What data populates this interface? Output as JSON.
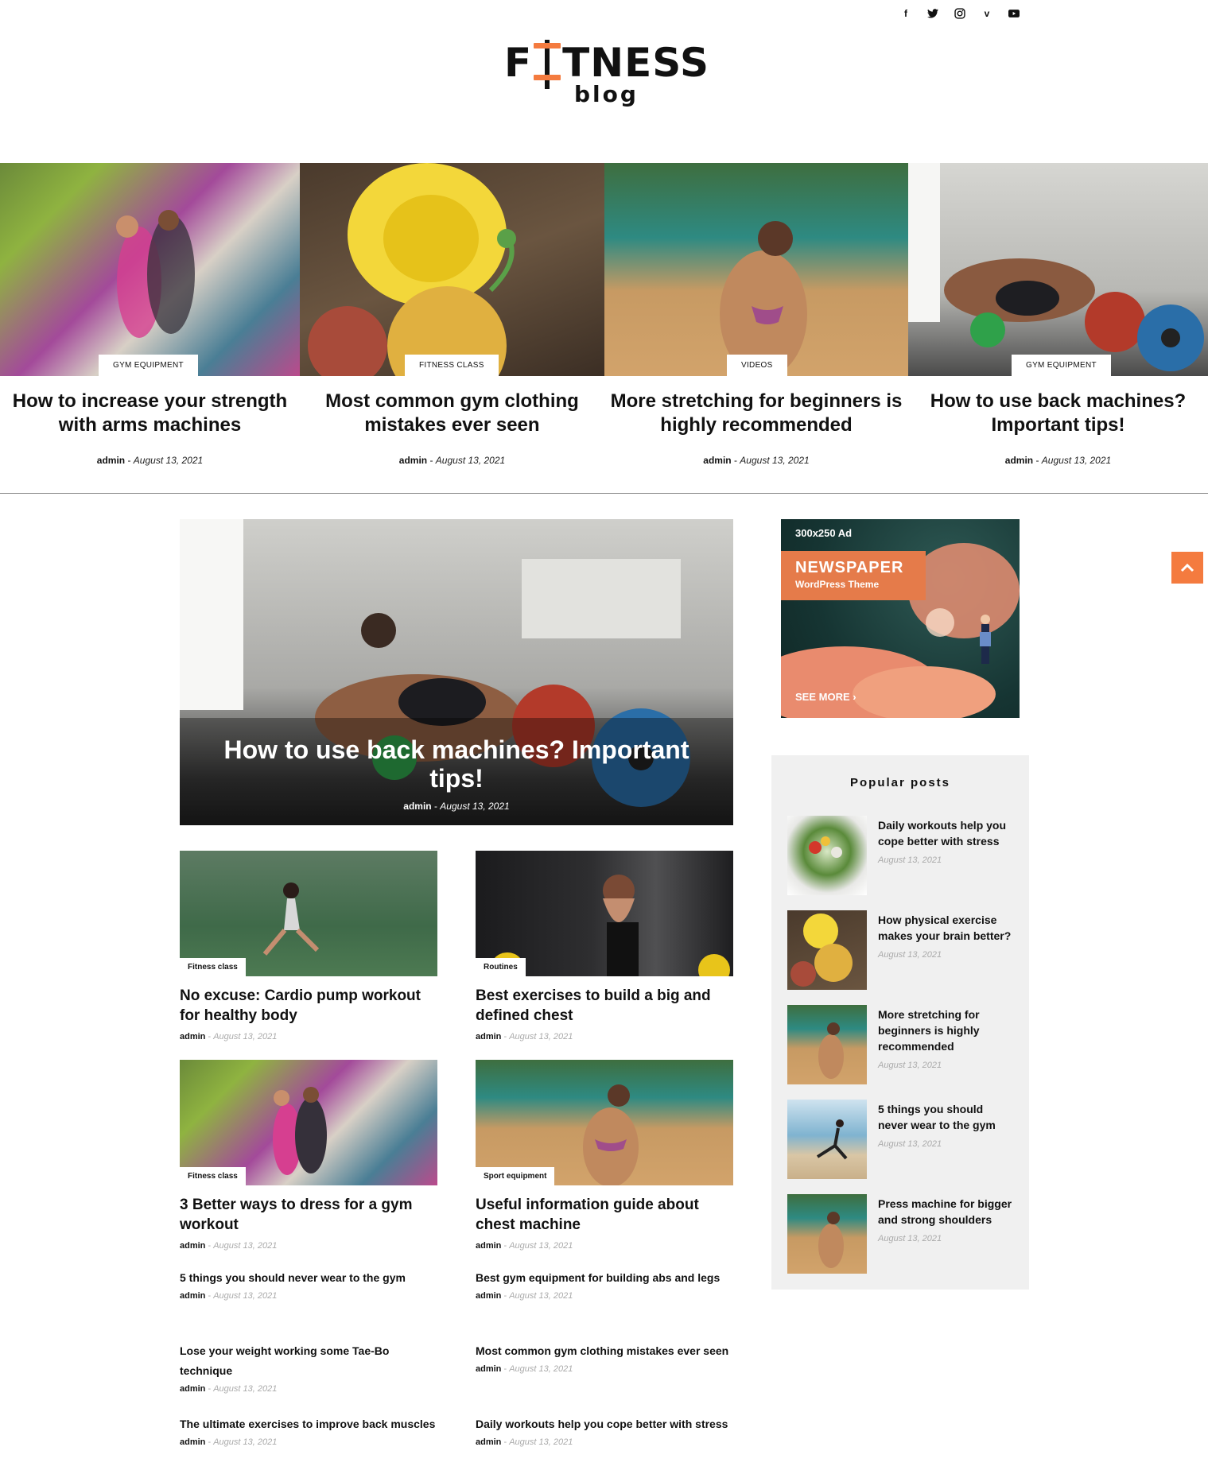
{
  "social": [
    {
      "icon": "facebook-icon",
      "glyph": "f"
    },
    {
      "icon": "twitter-icon",
      "glyph": "t"
    },
    {
      "icon": "instagram-icon",
      "glyph": "◎"
    },
    {
      "icon": "vimeo-icon",
      "glyph": "v"
    },
    {
      "icon": "youtube-icon",
      "glyph": "▶"
    }
  ],
  "logo": {
    "f": "F",
    "rest": "TNESS",
    "sub": "blog"
  },
  "featured": [
    {
      "category": "GYM EQUIPMENT",
      "title": "How to increase your strength with arms machines",
      "author": "admin",
      "date": "August 13, 2021"
    },
    {
      "category": "FITNESS CLASS",
      "title": "Most common gym clothing mistakes ever seen",
      "author": "admin",
      "date": "August 13, 2021"
    },
    {
      "category": "VIDEOS",
      "title": "More stretching for beginners is highly recommended",
      "author": "admin",
      "date": "August 13, 2021"
    },
    {
      "category": "GYM EQUIPMENT",
      "title": "How to use back machines? Important tips!",
      "author": "admin",
      "date": "August 13, 2021"
    }
  ],
  "hero": {
    "title": "How to use back machines? Important tips!",
    "author": "admin",
    "date": "August 13, 2021"
  },
  "cards": [
    {
      "category": "Fitness class",
      "title": "No excuse: Cardio pump workout for healthy body",
      "author": "admin",
      "date": "August 13, 2021"
    },
    {
      "category": "Routines",
      "title": "Best exercises to build a big and defined chest",
      "author": "admin",
      "date": "August 13, 2021"
    },
    {
      "category": "Fitness class",
      "title": "3 Better ways to dress for a gym workout",
      "author": "admin",
      "date": "August 13, 2021"
    },
    {
      "category": "Sport equipment",
      "title": "Useful information guide about chest machine",
      "author": "admin",
      "date": "August 13, 2021"
    }
  ],
  "left_list": [
    {
      "title": "5 things you should never wear to the gym",
      "author": "admin",
      "date": "August 13, 2021"
    },
    {
      "title": "Lose your weight working some Tae-Bo technique",
      "author": "admin",
      "date": "August 13, 2021"
    },
    {
      "title": "The ultimate exercises to improve back muscles",
      "author": "admin",
      "date": "August 13, 2021"
    }
  ],
  "right_list": [
    {
      "title": "Best gym equipment for building abs and legs",
      "author": "admin",
      "date": "August 13, 2021"
    },
    {
      "title": "Most common gym clothing mistakes ever seen",
      "author": "admin",
      "date": "August 13, 2021"
    },
    {
      "title": "Daily workouts help you cope better with stress",
      "author": "admin",
      "date": "August 13, 2021"
    }
  ],
  "ad": {
    "size": "300x250 Ad",
    "brand": "NEWSPAPER",
    "sub": "WordPress Theme",
    "cta": "SEE MORE ›"
  },
  "popular": {
    "heading": "Popular posts",
    "items": [
      {
        "title": "Daily workouts help you cope better with stress",
        "date": "August 13, 2021"
      },
      {
        "title": "How physical exercise makes your brain better?",
        "date": "August 13, 2021"
      },
      {
        "title": "More stretching for beginners is highly recommended",
        "date": "August 13, 2021"
      },
      {
        "title": "5 things you should never wear to the gym",
        "date": "August 13, 2021"
      },
      {
        "title": "Press machine for bigger and strong shoulders",
        "date": "August 13, 2021"
      }
    ]
  },
  "colors": {
    "accent": "#f47b3f",
    "text": "#111111",
    "muted": "#aaaaaa",
    "sidebar_bg": "#f0f0f0"
  },
  "to_top": "^"
}
